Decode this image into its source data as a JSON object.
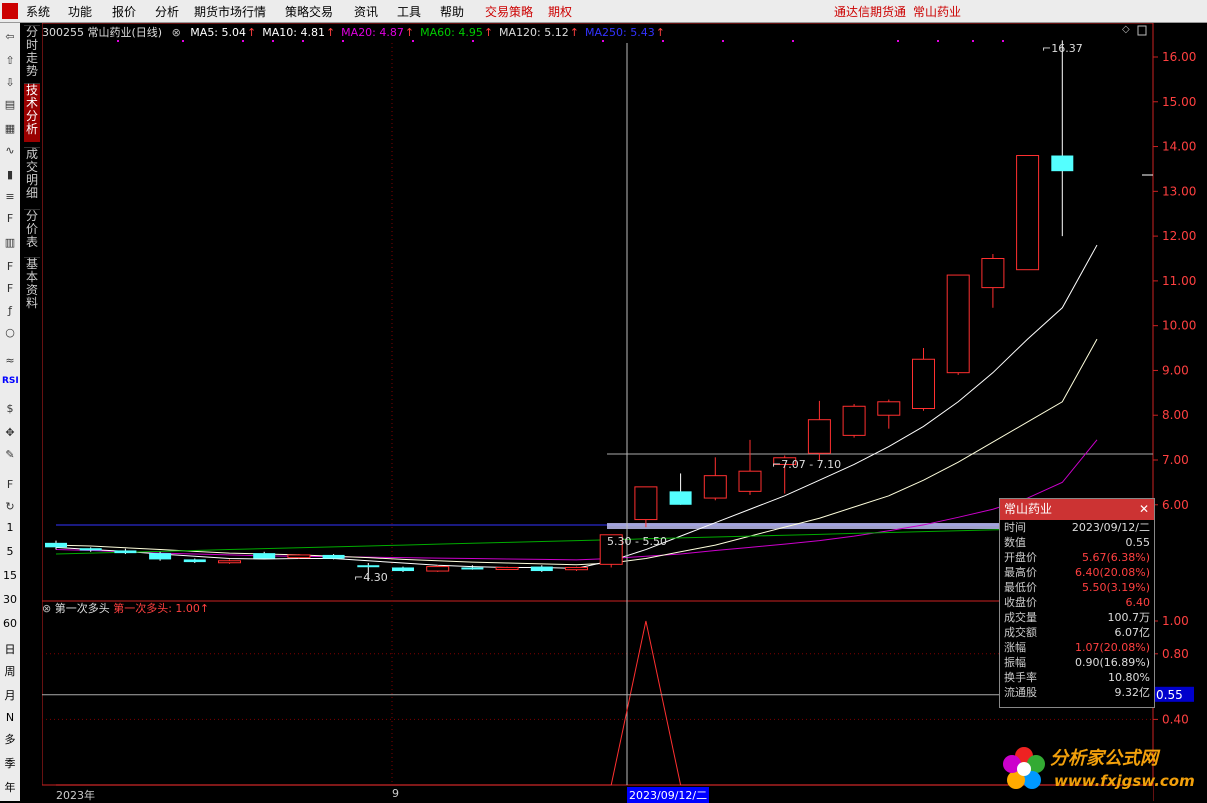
{
  "menu": {
    "items": [
      "系统",
      "功能",
      "报价",
      "分析",
      "期货市场行情",
      "策略交易",
      "资讯",
      "工具",
      "帮助",
      "交易策略",
      "期权"
    ],
    "app_title": "通达信期货通",
    "stock_title": "常山药业"
  },
  "left_toolbar": {
    "icons": [
      "back-arrow-icon",
      "up-arrow-icon",
      "down-arrow-icon",
      "quote-icon",
      "table-icon",
      "line-chart-icon",
      "candle-icon",
      "list-icon",
      "f10-icon",
      "notes-icon",
      "f-icon",
      "f2-icon",
      "formula-icon",
      "circle-icon",
      "indicator-icon",
      "rsi-icon",
      "money-icon",
      "move-icon",
      "pencil-icon",
      "fs-icon",
      "refresh-icon"
    ],
    "rsi_label": "RSI",
    "periods": [
      "1",
      "5",
      "15",
      "30",
      "60",
      "日",
      "周",
      "月",
      "N",
      "多",
      "季",
      "年"
    ]
  },
  "vertical_tabs": [
    "分时走势",
    "技术分析",
    "成交明细",
    "分价表",
    "基本资料"
  ],
  "chart_header": {
    "code_name": "300255 常山药业(日线)",
    "mas": [
      {
        "label": "MA5: 5.04",
        "color": "#ffffff"
      },
      {
        "label": "MA10: 4.81",
        "color": "#ffffff"
      },
      {
        "label": "MA20: 4.87",
        "color": "#e000e0"
      },
      {
        "label": "MA60: 4.95",
        "color": "#00cc00"
      },
      {
        "label": "MA120: 5.12",
        "color": "#dddddd"
      },
      {
        "label": "MA250: 5.43",
        "color": "#3333ff"
      }
    ],
    "up_arrow": "↑"
  },
  "price_axis": {
    "labels": [
      "16.00",
      "15.00",
      "14.00",
      "13.00",
      "12.00",
      "11.00",
      "10.00",
      "9.00",
      "8.00",
      "7.00",
      "6.00"
    ]
  },
  "indicator_axis": {
    "labels": [
      "1.00",
      "0.80",
      "0.55",
      "0.40"
    ],
    "current": "0.55"
  },
  "annotations": {
    "high": "16.37",
    "low": "4.30",
    "mid1": "7.07 - 7.10",
    "mid2": "5.30 - 5.50"
  },
  "subchart": {
    "name": "第一次多头",
    "value_label": "第一次多头: 1.00",
    "arrow": "↑"
  },
  "dates": {
    "start": "2023年",
    "month": "9",
    "cursor": "2023/09/12/二"
  },
  "popup": {
    "title": "常山药业",
    "rows": [
      {
        "k": "时间",
        "v": "2023/09/12/二",
        "c": "#ddd"
      },
      {
        "k": "数值",
        "v": "0.55",
        "c": "#ddd"
      },
      {
        "k": "开盘价",
        "v": "5.67(6.38%)",
        "c": "#ff4040"
      },
      {
        "k": "最高价",
        "v": "6.40(20.08%)",
        "c": "#ff4040"
      },
      {
        "k": "最低价",
        "v": "5.50(3.19%)",
        "c": "#ff4040"
      },
      {
        "k": "收盘价",
        "v": "6.40",
        "c": "#ff4040"
      },
      {
        "k": "成交量",
        "v": "100.7万",
        "c": "#ddd"
      },
      {
        "k": "成交额",
        "v": "6.07亿",
        "c": "#ddd"
      },
      {
        "k": "涨幅",
        "v": "1.07(20.08%)",
        "c": "#ff4040"
      },
      {
        "k": "振幅",
        "v": "0.90(16.89%)",
        "c": "#ddd"
      },
      {
        "k": "换手率",
        "v": "10.80%",
        "c": "#ddd"
      },
      {
        "k": "流通股",
        "v": "9.32亿",
        "c": "#ddd"
      }
    ]
  },
  "watermark": {
    "cn": "分析家公式网",
    "url": "www.fxjgsw.com"
  },
  "colors": {
    "up": "#ff3030",
    "down": "#54ffff",
    "grid": "#800000",
    "axis": "#cc2222"
  },
  "chart_data": {
    "type": "candlestick",
    "ylim": [
      4.0,
      16.5
    ],
    "candles": [
      {
        "o": 5.15,
        "h": 5.2,
        "l": 5.0,
        "c": 5.05
      },
      {
        "o": 5.03,
        "h": 5.05,
        "l": 4.95,
        "c": 4.98
      },
      {
        "o": 4.98,
        "h": 5.02,
        "l": 4.9,
        "c": 4.92
      },
      {
        "o": 4.92,
        "h": 4.95,
        "l": 4.75,
        "c": 4.78
      },
      {
        "o": 4.78,
        "h": 4.8,
        "l": 4.7,
        "c": 4.72
      },
      {
        "o": 4.72,
        "h": 4.78,
        "l": 4.68,
        "c": 4.75
      },
      {
        "o": 4.92,
        "h": 4.95,
        "l": 4.78,
        "c": 4.8
      },
      {
        "o": 4.82,
        "h": 4.9,
        "l": 4.8,
        "c": 4.88
      },
      {
        "o": 4.88,
        "h": 4.9,
        "l": 4.78,
        "c": 4.8
      },
      {
        "o": 4.65,
        "h": 4.7,
        "l": 4.3,
        "c": 4.62
      },
      {
        "o": 4.6,
        "h": 4.62,
        "l": 4.5,
        "c": 4.52
      },
      {
        "o": 4.52,
        "h": 4.65,
        "l": 4.5,
        "c": 4.62
      },
      {
        "o": 4.6,
        "h": 4.65,
        "l": 4.55,
        "c": 4.58
      },
      {
        "o": 4.58,
        "h": 4.62,
        "l": 4.55,
        "c": 4.6
      },
      {
        "o": 4.62,
        "h": 4.65,
        "l": 4.5,
        "c": 4.52
      },
      {
        "o": 4.55,
        "h": 4.62,
        "l": 4.52,
        "c": 4.6
      },
      {
        "o": 4.67,
        "h": 5.33,
        "l": 4.6,
        "c": 5.33
      },
      {
        "o": 5.67,
        "h": 6.4,
        "l": 5.5,
        "c": 6.4
      },
      {
        "o": 6.3,
        "h": 6.7,
        "l": 6.0,
        "c": 6.0
      },
      {
        "o": 6.15,
        "h": 7.06,
        "l": 6.1,
        "c": 6.65
      },
      {
        "o": 6.3,
        "h": 7.45,
        "l": 6.22,
        "c": 6.75
      },
      {
        "o": 6.9,
        "h": 7.1,
        "l": 6.25,
        "c": 7.05
      },
      {
        "o": 7.15,
        "h": 8.32,
        "l": 7.0,
        "c": 7.9
      },
      {
        "o": 7.55,
        "h": 8.25,
        "l": 7.5,
        "c": 8.2
      },
      {
        "o": 8.0,
        "h": 8.35,
        "l": 7.7,
        "c": 8.3
      },
      {
        "o": 8.15,
        "h": 9.5,
        "l": 8.1,
        "c": 9.25
      },
      {
        "o": 8.95,
        "h": 11.13,
        "l": 8.9,
        "c": 11.13
      },
      {
        "o": 10.85,
        "h": 11.6,
        "l": 10.4,
        "c": 11.5
      },
      {
        "o": 11.25,
        "h": 13.8,
        "l": 11.25,
        "c": 13.8
      },
      {
        "o": 13.8,
        "h": 16.37,
        "l": 12.0,
        "c": 13.45
      }
    ],
    "ma5": [
      5.05,
      5.0,
      4.96,
      4.9,
      4.85,
      4.8,
      4.79,
      4.8,
      4.8,
      4.75,
      4.7,
      4.65,
      4.62,
      4.6,
      4.6,
      4.58,
      4.75,
      5.0,
      5.3,
      5.6,
      5.9,
      6.2,
      6.55,
      6.9,
      7.3,
      7.75,
      8.3,
      8.95,
      9.7,
      10.4,
      11.8
    ],
    "ma10": [
      5.1,
      5.08,
      5.04,
      5.0,
      4.96,
      4.92,
      4.9,
      4.88,
      4.85,
      4.82,
      4.78,
      4.75,
      4.72,
      4.7,
      4.68,
      4.66,
      4.7,
      4.8,
      4.95,
      5.1,
      5.3,
      5.5,
      5.7,
      5.95,
      6.2,
      6.55,
      6.95,
      7.4,
      7.85,
      8.3,
      9.7
    ],
    "ma20": [
      5.0,
      4.98,
      4.95,
      4.92,
      4.9,
      4.88,
      4.86,
      4.85,
      4.84,
      4.83,
      4.82,
      4.81,
      4.8,
      4.79,
      4.78,
      4.77,
      4.8,
      4.85,
      4.9,
      4.98,
      5.05,
      5.12,
      5.2,
      5.3,
      5.42,
      5.55,
      5.72,
      5.9,
      6.15,
      6.5,
      7.45
    ],
    "ma250_level": 5.43,
    "ma120_level": 5.12,
    "indicator": [
      0,
      0,
      0,
      0,
      0,
      0,
      0,
      0,
      0,
      0,
      0,
      0,
      0,
      0,
      0,
      0,
      0,
      1,
      0,
      0,
      0,
      0,
      0,
      0,
      0,
      0,
      0,
      0,
      0,
      0
    ]
  }
}
